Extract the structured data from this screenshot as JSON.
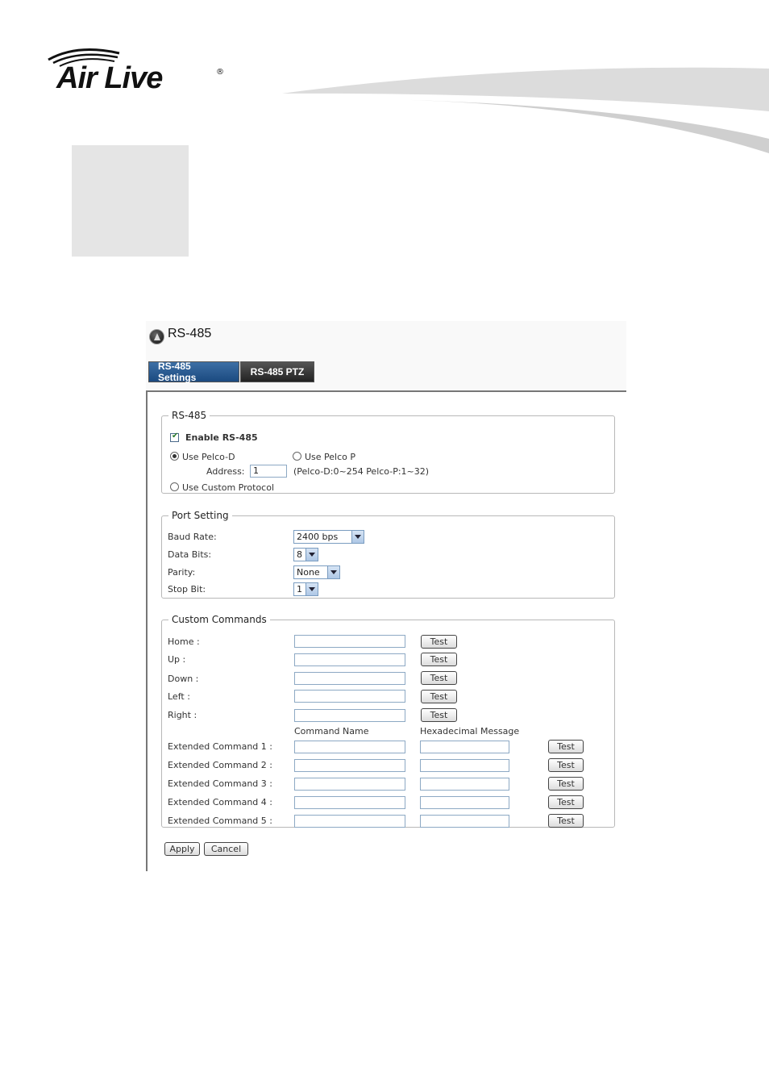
{
  "brand": {
    "logo_text": "Air Live",
    "registered_mark": "®"
  },
  "panel": {
    "title": "RS-485",
    "title_icon": "camera-logo-icon"
  },
  "tabs": [
    {
      "label": "RS-485 Settings",
      "active": true
    },
    {
      "label": "RS-485 PTZ",
      "active": false
    }
  ],
  "rs485": {
    "legend": "RS-485",
    "enable_label": "Enable RS-485",
    "enable_checked": true,
    "pelco_d_label": "Use Pelco-D",
    "pelco_p_label": "Use Pelco P",
    "address_label": "Address:",
    "address_value": "1",
    "address_hint": "(Pelco-D:0~254 Pelco-P:1~32)",
    "custom_protocol_label": "Use Custom Protocol",
    "selected_protocol": "Use Pelco-D"
  },
  "port": {
    "legend": "Port Setting",
    "baud_label": "Baud Rate:",
    "baud_value": "2400 bps",
    "data_bits_label": "Data Bits:",
    "data_bits_value": "8",
    "parity_label": "Parity:",
    "parity_value": "None",
    "stop_bit_label": "Stop Bit:",
    "stop_bit_value": "1"
  },
  "custom": {
    "legend": "Custom Commands",
    "basic": [
      {
        "label": "Home :",
        "value": "",
        "test": "Test"
      },
      {
        "label": "Up :",
        "value": "",
        "test": "Test"
      },
      {
        "label": "Down :",
        "value": "",
        "test": "Test"
      },
      {
        "label": "Left :",
        "value": "",
        "test": "Test"
      },
      {
        "label": "Right :",
        "value": "",
        "test": "Test"
      }
    ],
    "col_name": "Command Name",
    "col_hex": "Hexadecimal Message",
    "extended": [
      {
        "label": "Extended Command 1 :",
        "name": "",
        "hex": "",
        "test": "Test"
      },
      {
        "label": "Extended Command 2 :",
        "name": "",
        "hex": "",
        "test": "Test"
      },
      {
        "label": "Extended Command 3 :",
        "name": "",
        "hex": "",
        "test": "Test"
      },
      {
        "label": "Extended Command 4 :",
        "name": "",
        "hex": "",
        "test": "Test"
      },
      {
        "label": "Extended Command 5 :",
        "name": "",
        "hex": "",
        "test": "Test"
      }
    ]
  },
  "actions": {
    "apply": "Apply",
    "cancel": "Cancel"
  }
}
